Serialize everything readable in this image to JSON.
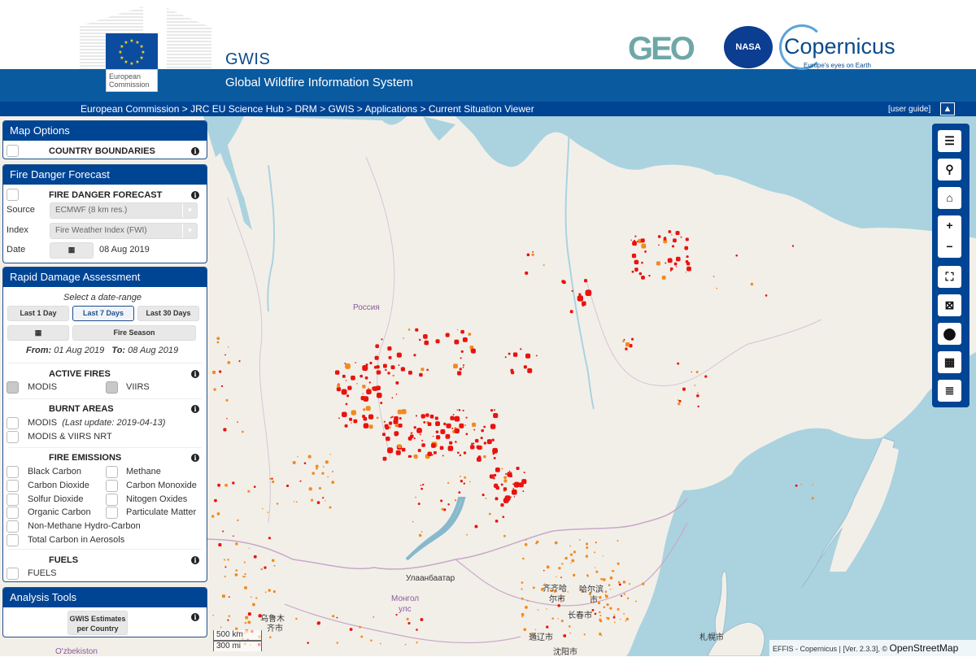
{
  "header": {
    "ec_logo_text": "European Commission",
    "app_short": "GWIS",
    "app_title": "Global Wildfire Information System",
    "partners": [
      "GEO",
      "NASA",
      "Copernicus"
    ],
    "copernicus_tagline": "Europe's eyes on Earth"
  },
  "breadcrumb": {
    "text": "European Commission > JRC EU Science Hub > DRM > GWIS > Applications > Current Situation Viewer",
    "user_guide": "[user guide]",
    "up_icon": "arrow-up-icon"
  },
  "map_options": {
    "title": "Map Options",
    "country_boundaries": "COUNTRY BOUNDARIES"
  },
  "fire_danger": {
    "title": "Fire Danger Forecast",
    "section": "FIRE DANGER FORECAST",
    "source_label": "Source",
    "source_value": "ECMWF (8 km res.)",
    "index_label": "Index",
    "index_value": "Fire Weather Index (FWI)",
    "date_label": "Date",
    "date_value": "08 Aug 2019"
  },
  "rapid_damage": {
    "title": "Rapid Damage Assessment",
    "prompt": "Select a date-range",
    "range_buttons": [
      "Last 1 Day",
      "Last 7 Days",
      "Last 30 Days"
    ],
    "selected_range": "Last 7 Days",
    "fire_season": "Fire Season",
    "from_label": "From:",
    "from_value": "01 Aug 2019",
    "to_label": "To:",
    "to_value": "08 Aug 2019",
    "active_fires": {
      "title": "ACTIVE FIRES",
      "options": [
        "MODIS",
        "VIIRS"
      ]
    },
    "burnt_areas": {
      "title": "BURNT AREAS",
      "modis": "MODIS",
      "modis_note": "(Last update: 2019-04-13)",
      "nrt": "MODIS & VIIRS NRT"
    },
    "fire_emissions": {
      "title": "FIRE EMISSIONS",
      "left": [
        "Black Carbon",
        "Carbon Dioxide",
        "Solfur Dioxide",
        "Organic Carbon",
        "Non-Methane Hydro-Carbon",
        "Total Carbon in Aerosols"
      ],
      "right": [
        "Methane",
        "Carbon Monoxide",
        "Nitogen Oxides",
        "Particulate Matter"
      ]
    },
    "fuels": {
      "title": "FUELS",
      "option": "FUELS"
    }
  },
  "analysis_tools": {
    "title": "Analysis Tools",
    "button_line1": "GWIS Estimates",
    "button_line2": "per Country"
  },
  "toolbar": {
    "buttons": [
      "menu-icon",
      "search-icon",
      "home-icon",
      "zoom-in-icon",
      "zoom-out-icon",
      "fullscreen-icon",
      "extent-icon",
      "location-pin-icon",
      "grid-icon",
      "legend-list-icon"
    ],
    "glyphs": [
      "☰",
      "⚲",
      "⌂",
      "+",
      "−",
      "⛶",
      "⊠",
      "⬤",
      "▦",
      "≣"
    ]
  },
  "map": {
    "labels": {
      "russia": "Россия",
      "mongolia_1": "Монгол",
      "mongolia_2": "улс",
      "ulaanbaatar": "Улаанбаатар",
      "urumqi_1": "乌鲁木",
      "urumqi_2": "齐市",
      "qiqihar_1": "齐齐哈",
      "qiqihar_2": "尔市",
      "harbin_1": "哈尔滨",
      "harbin_2": "市",
      "changchun": "长春市",
      "tongliao": "通辽市",
      "shenyang": "沈阳市",
      "sapporo": "札幌市",
      "uzbekistan": "O'zbekiston"
    },
    "scale_km": "500 km",
    "scale_mi": "300 mi",
    "attribution": "EFFIS - Copernicus | [Ver. 2.3.3], ©",
    "attribution_osm": "OpenStreetMap",
    "fire_colors": {
      "high": "#e8130f",
      "low": "#f28a1e"
    }
  }
}
